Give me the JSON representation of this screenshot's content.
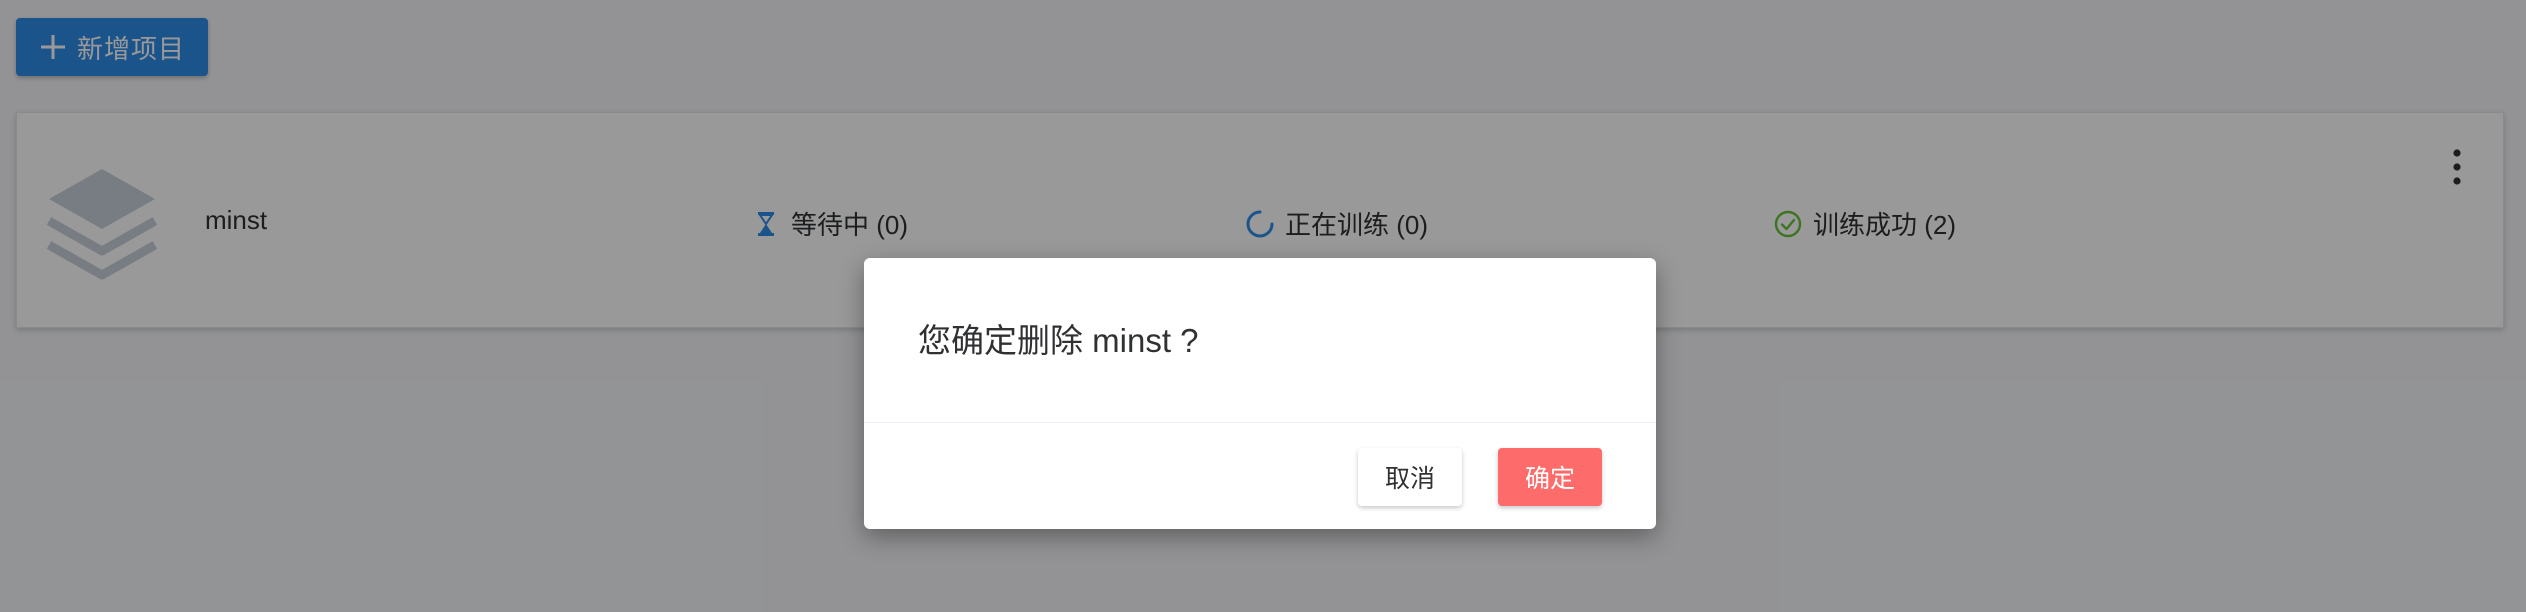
{
  "toolbar": {
    "add_project_label": "新增项目"
  },
  "project": {
    "name": "minst",
    "stats": {
      "waiting": "等待中 (0)",
      "training": "正在训练 (0)",
      "success": "训练成功 (2)"
    }
  },
  "dialog": {
    "message": "您确定删除 minst ?",
    "cancel_label": "取消",
    "confirm_label": "确定"
  },
  "icons": {
    "add": "plus-icon",
    "project": "layers-stack-icon",
    "waiting": "hourglass-icon",
    "training": "spinner-icon",
    "success": "check-circle-icon",
    "more": "more-vertical-icon"
  },
  "colors": {
    "primary": "#2d8de8",
    "danger": "#fe6b6b",
    "success": "#67c23a",
    "icon_gray": "#c8d1dd"
  }
}
